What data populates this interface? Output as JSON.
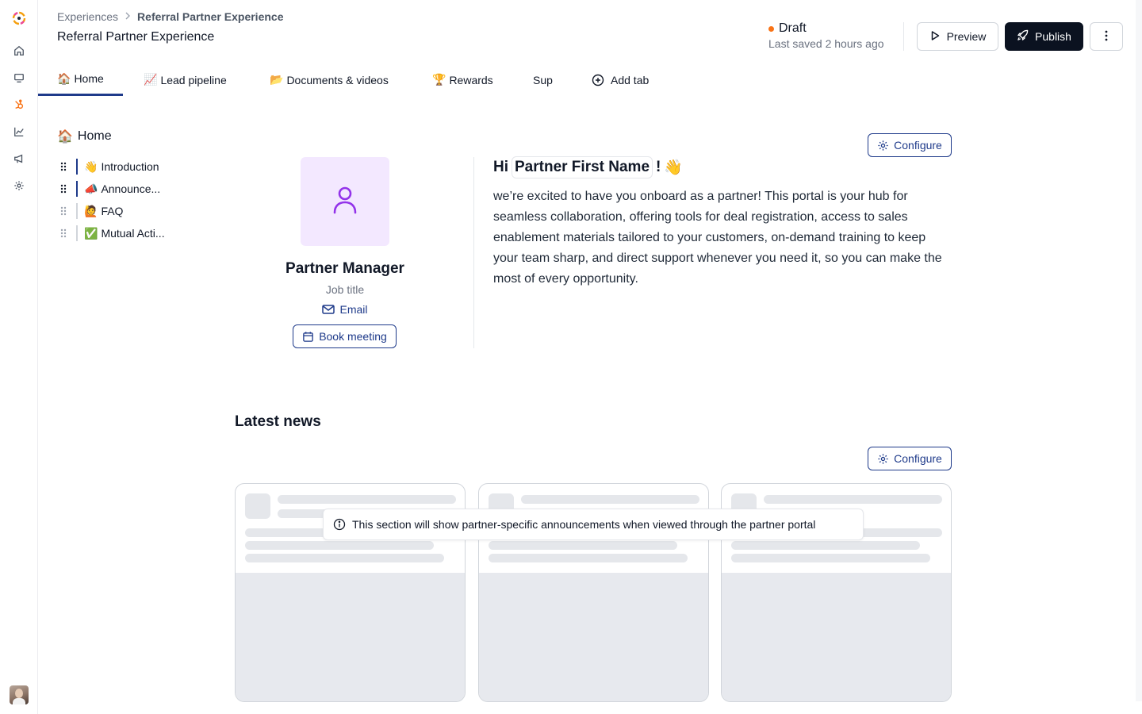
{
  "breadcrumb": {
    "parent": "Experiences",
    "separator": ">",
    "current": "Referral Partner Experience"
  },
  "page_title": "Referral Partner Experience",
  "status": {
    "label": "Draft",
    "saved": "Last saved 2 hours ago",
    "dot_color": "#f97316"
  },
  "actions": {
    "preview": "Preview",
    "publish": "Publish"
  },
  "rail": {
    "icons": [
      "home-icon",
      "monitor-icon",
      "hubspot-icon",
      "chart-icon",
      "megaphone-icon",
      "gear-icon"
    ]
  },
  "tabs": [
    {
      "emoji": "🏠",
      "label": "Home",
      "active": true
    },
    {
      "emoji": "📈",
      "label": "Lead pipeline"
    },
    {
      "emoji": "📂",
      "label": "Documents & videos"
    },
    {
      "emoji": "🏆",
      "label": "Rewards"
    },
    {
      "emoji": "",
      "label": "Sup"
    },
    {
      "emoji": "",
      "label": "Add tab"
    }
  ],
  "outline": {
    "title": "Home",
    "title_emoji": "🏠",
    "items": [
      {
        "emoji": "👋",
        "label": "Introduction"
      },
      {
        "emoji": "📣",
        "label": "Announce..."
      },
      {
        "emoji": "🙋",
        "label": "FAQ"
      },
      {
        "emoji": "✅",
        "label": "Mutual Acti..."
      }
    ]
  },
  "partner_card": {
    "name": "Partner Manager",
    "job_title": "Job title",
    "email_label": "Email",
    "book_label": "Book meeting"
  },
  "configure_label": "Configure",
  "welcome": {
    "hi": "Hi",
    "token": "Partner First Name",
    "exclaim": "!",
    "wave": "👋",
    "body": "we’re excited to have you onboard as a partner! This portal is your hub for seamless collaboration, offering tools for deal registration, access to sales enablement materials tailored to your customers, on-demand training to keep your team sharp, and direct support whenever you need it, so you can make the most of every opportunity."
  },
  "news": {
    "title": "Latest news",
    "notice": "This section will show partner-specific announcements when viewed through the partner portal"
  },
  "colors": {
    "accent": "#1e3a8a",
    "publish_bg": "#0b1220",
    "avatar_bg": "#f3e8ff",
    "avatar_icon": "#9333ea"
  }
}
